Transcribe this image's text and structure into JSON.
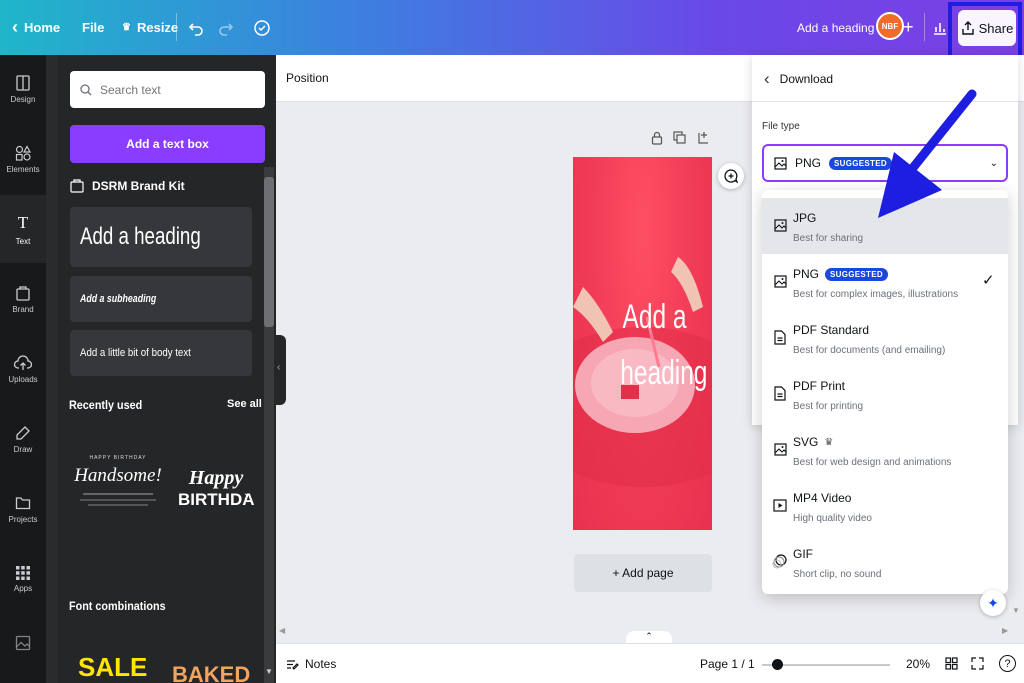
{
  "topbar": {
    "home_label": "Home",
    "file_label": "File",
    "resize_label": "Resize",
    "doc_title": "Add a heading",
    "avatar_text": "NBF",
    "share_label": "Share"
  },
  "rail": {
    "items": [
      {
        "label": "Design",
        "icon": "design-icon"
      },
      {
        "label": "Elements",
        "icon": "elements-icon"
      },
      {
        "label": "Text",
        "icon": "text-icon"
      },
      {
        "label": "Brand",
        "icon": "brand-icon"
      },
      {
        "label": "Uploads",
        "icon": "uploads-icon"
      },
      {
        "label": "Draw",
        "icon": "draw-icon"
      },
      {
        "label": "Projects",
        "icon": "projects-icon"
      },
      {
        "label": "Apps",
        "icon": "apps-icon"
      },
      {
        "label": "Photos",
        "icon": "photos-icon"
      }
    ]
  },
  "panel": {
    "search_placeholder": "Search text",
    "add_textbox_label": "Add a text box",
    "brand_kit_label": "DSRM Brand Kit",
    "heading_label": "Add a heading",
    "subheading_label": "Add a subheading",
    "body_label": "Add a little bit of body text",
    "recently_used_label": "Recently used",
    "see_all_label": "See all",
    "font_combinations_label": "Font combinations",
    "template1_small": "HAPPY BIRTHDAY",
    "template1_title": "Handsome!",
    "template2_line1": "Happy",
    "template2_line2": "BIRTHDA",
    "sale_text": "SALE",
    "baked_text": "BAKED"
  },
  "canvas": {
    "context_label": "Position",
    "design_heading": "Add a heading",
    "add_page_label": "+ Add page"
  },
  "bottombar": {
    "notes_label": "Notes",
    "page_indicator": "Page 1 / 1",
    "zoom_level": "20%",
    "zoom_fraction": 0.12
  },
  "download": {
    "back_label": "Download",
    "file_type_label": "File type",
    "selected_value": "PNG",
    "selected_badge": "SUGGESTED",
    "options": [
      {
        "title": "JPG",
        "desc": "Best for sharing",
        "icon": "image-icon"
      },
      {
        "title": "PNG",
        "badge": "SUGGESTED",
        "desc": "Best for complex images, illustrations",
        "icon": "image-icon",
        "checked": true
      },
      {
        "title": "PDF Standard",
        "desc": "Best for documents (and emailing)",
        "icon": "document-icon"
      },
      {
        "title": "PDF Print",
        "desc": "Best for printing",
        "icon": "document-icon"
      },
      {
        "title": "SVG",
        "crown": "♛",
        "desc": "Best for web design and animations",
        "icon": "image-icon"
      },
      {
        "title": "MP4 Video",
        "desc": "High quality video",
        "icon": "video-icon"
      },
      {
        "title": "GIF",
        "desc": "Short clip, no sound",
        "icon": "gif-icon"
      }
    ]
  },
  "colors": {
    "accent": "#8b3dff",
    "badge": "#1a47e0",
    "annotation": "#1d1ee0"
  }
}
